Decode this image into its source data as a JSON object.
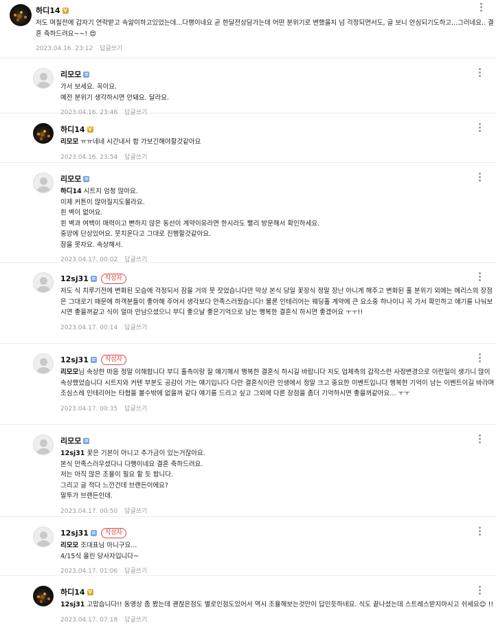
{
  "comments": [
    {
      "nick": "하디14",
      "badge": "V",
      "is_author": false,
      "avatar": "photo",
      "mention": "",
      "text": "저도 며칠전에 갑자기 연락받고 속앓이하고있었는데...다행이네요 곧 한달전상담가는데 어떤 분위기로 변했을지 넘 걱정되면서도, 글 보니 안심되기도하고...그러네요.. 결혼 축하드려요~~! 😍",
      "date": "2023.04.16. 23:12",
      "reply_label": "답글쓰기"
    },
    {
      "nick": "리모모",
      "badge": "≡",
      "is_author": false,
      "avatar": "default",
      "mention": "",
      "text": "가서 보세요. 꼭이요.\n예전 분위기 생각하시면 안돼요. 달라요.",
      "date": "2023.04.16. 23:46",
      "reply_label": "답글쓰기"
    },
    {
      "nick": "하디14",
      "badge": "V",
      "is_author": false,
      "avatar": "photo",
      "mention": "리모모",
      "text": " ㅠㅠ네네 시간내서 함 가보긴해야할것같아요",
      "date": "2023.04.16. 23:54",
      "reply_label": "답글쓰기"
    },
    {
      "nick": "리모모",
      "badge": "≡",
      "is_author": false,
      "avatar": "default",
      "mention": "하디14",
      "text": " 시트지 엄청 많아요.\n이제 커튼이 많아질지도몰라요.\n흰 벽이 없어요.\n흰 벽과 여백이 매력이고 뻔하지 않은 동선이 계약이유라면 한시라도 빨리 방문해서 확인하세요.\n중앙에 단상있어요. 뭇치운다고 그대로 진행할것같아요.\n잠을 못자요. 속상해서.",
      "date": "2023.04.17. 00:02",
      "reply_label": "답글쓰기"
    },
    {
      "nick": "12sj31",
      "badge": "≡",
      "is_author": true,
      "avatar": "default",
      "mention": "",
      "text": "저도 식 치루기전에 변화된 모습에 걱정되서 잠을 거의 못 잣었습니다만 막상 본식 당일 꽃장식 정말 장난 아니게 해주고 변화된 홀 분위기 외에는 메리스의 장점은 그대로기 때문에 하객분들이 좋아해 주어서 생각보다 만족스러웠습니다! 물론 인테리어는 웨딩홀 계약에 큰 요소중 하나이니 꼭 가서 확인하고 얘기를 나눠보시면 좋을꺼같고 식이 얼마 안남으셨으니 부디 좋으날 좋은기억으로 남는 행복한 결혼식 하시면 좋겠어요 ㅜㅜ!!",
      "date": "2023.04.17. 00:14",
      "reply_label": "답글쓰기"
    },
    {
      "nick": "12sj31",
      "badge": "≡",
      "is_author": true,
      "avatar": "default",
      "mention": "리모모",
      "text": "님 속상한 마음 정말 이해합니다 부디 홀측이랑 잘 얘기해서 행복한 결혼식 하시길 바랍니다 저도 업체측의 갑작스런 사정변경으로 이런일이 생기니 많이 속상했었습니다 시트지와 커텐 부분도 공감이 가는 얘기입니다 다만 결혼식이란 인생에서 정말 크고 중요한 이벤트입니다 행복한 기억이 남는 이벤트이길 바라며 조심스레 인테리어는 타협을 볼수밖에 없을꺼 같다 얘기를 드리고 싶고 그외에 다른 장점을 좀더 기억하시면 좋을꺼같아요... ㅜㅜ",
      "date": "2023.04.17. 00:35",
      "reply_label": "답글쓰기"
    },
    {
      "nick": "리모모",
      "badge": "≡",
      "is_author": false,
      "avatar": "default",
      "mention": "12sj31",
      "text": " 꽃은 기본이 아니고 추가금이 있는거잖아요.\n본식 만족스러우셨다니 다행이네요 결혼 축하드려요.\n저는 아직 많은 조율이 필요 할 듯 합니다.\n그리고 글 적다 느낀건데 브랜든이에요?\n말투가 브랜든인데.",
      "date": "2023.04.17. 00:50",
      "reply_label": "답글쓰기"
    },
    {
      "nick": "12sj31",
      "badge": "≡",
      "is_author": true,
      "avatar": "default",
      "mention": "리모모",
      "text": " 조대표님 아니구요...\n4/15식 올린 당사자입니다~",
      "date": "2023.04.17. 01:06",
      "reply_label": "답글쓰기"
    },
    {
      "nick": "하디14",
      "badge": "V",
      "is_author": false,
      "avatar": "photo",
      "mention": "12sj31",
      "text": " 고맙습니다!! 동영상 좀 봤는데 괜찮은점도 별로인점도있어서 역시 조율해보는것만이 답인듯하네요. 식도 끝나셨는데 스트레스받지마시고 쉬세요😊 !!",
      "date": "2023.04.17. 07:18",
      "reply_label": "답글쓰기"
    }
  ],
  "labels": {
    "author_tag": "작성자"
  }
}
